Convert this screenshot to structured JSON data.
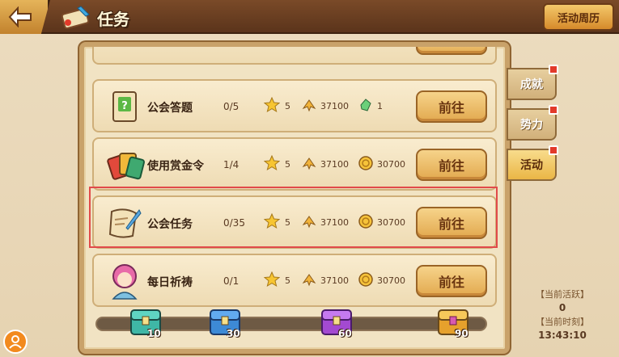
{
  "header": {
    "title": "任务",
    "calendar_label": "活动周历"
  },
  "tasks": [
    {
      "name": "公会答题",
      "progress": "0/5",
      "star": "5",
      "exp": "37100",
      "third": "1",
      "third_icon": "green-gem-icon",
      "button": "前往",
      "icon": "quiz-board-icon"
    },
    {
      "name": "使用赏金令",
      "progress": "1/4",
      "star": "5",
      "exp": "37100",
      "third": "30700",
      "third_icon": "gold-coin-icon",
      "button": "前往",
      "icon": "bounty-cards-icon"
    },
    {
      "name": "公会任务",
      "progress": "0/35",
      "star": "5",
      "exp": "37100",
      "third": "30700",
      "third_icon": "gold-coin-icon",
      "button": "前往",
      "icon": "scroll-quill-icon"
    },
    {
      "name": "每日祈祷",
      "progress": "0/1",
      "star": "5",
      "exp": "37100",
      "third": "30700",
      "third_icon": "gold-coin-icon",
      "button": "前往",
      "icon": "pink-hair-girl-icon"
    }
  ],
  "side_tabs": [
    {
      "label": "成就",
      "badge": true
    },
    {
      "label": "势力",
      "badge": true
    },
    {
      "label": "活动",
      "badge": true,
      "active": true
    }
  ],
  "rewards": [
    {
      "value": "10",
      "color": "#3fb7a6"
    },
    {
      "value": "30",
      "color": "#3d8ad6"
    },
    {
      "value": "60",
      "color": "#a34ad1"
    },
    {
      "value": "90",
      "color": "#e6a12c"
    }
  ],
  "activity": {
    "active_label": "【当前活跃】",
    "active_value": "0",
    "time_label": "【当前时刻】",
    "time_value": "13:43:10"
  }
}
